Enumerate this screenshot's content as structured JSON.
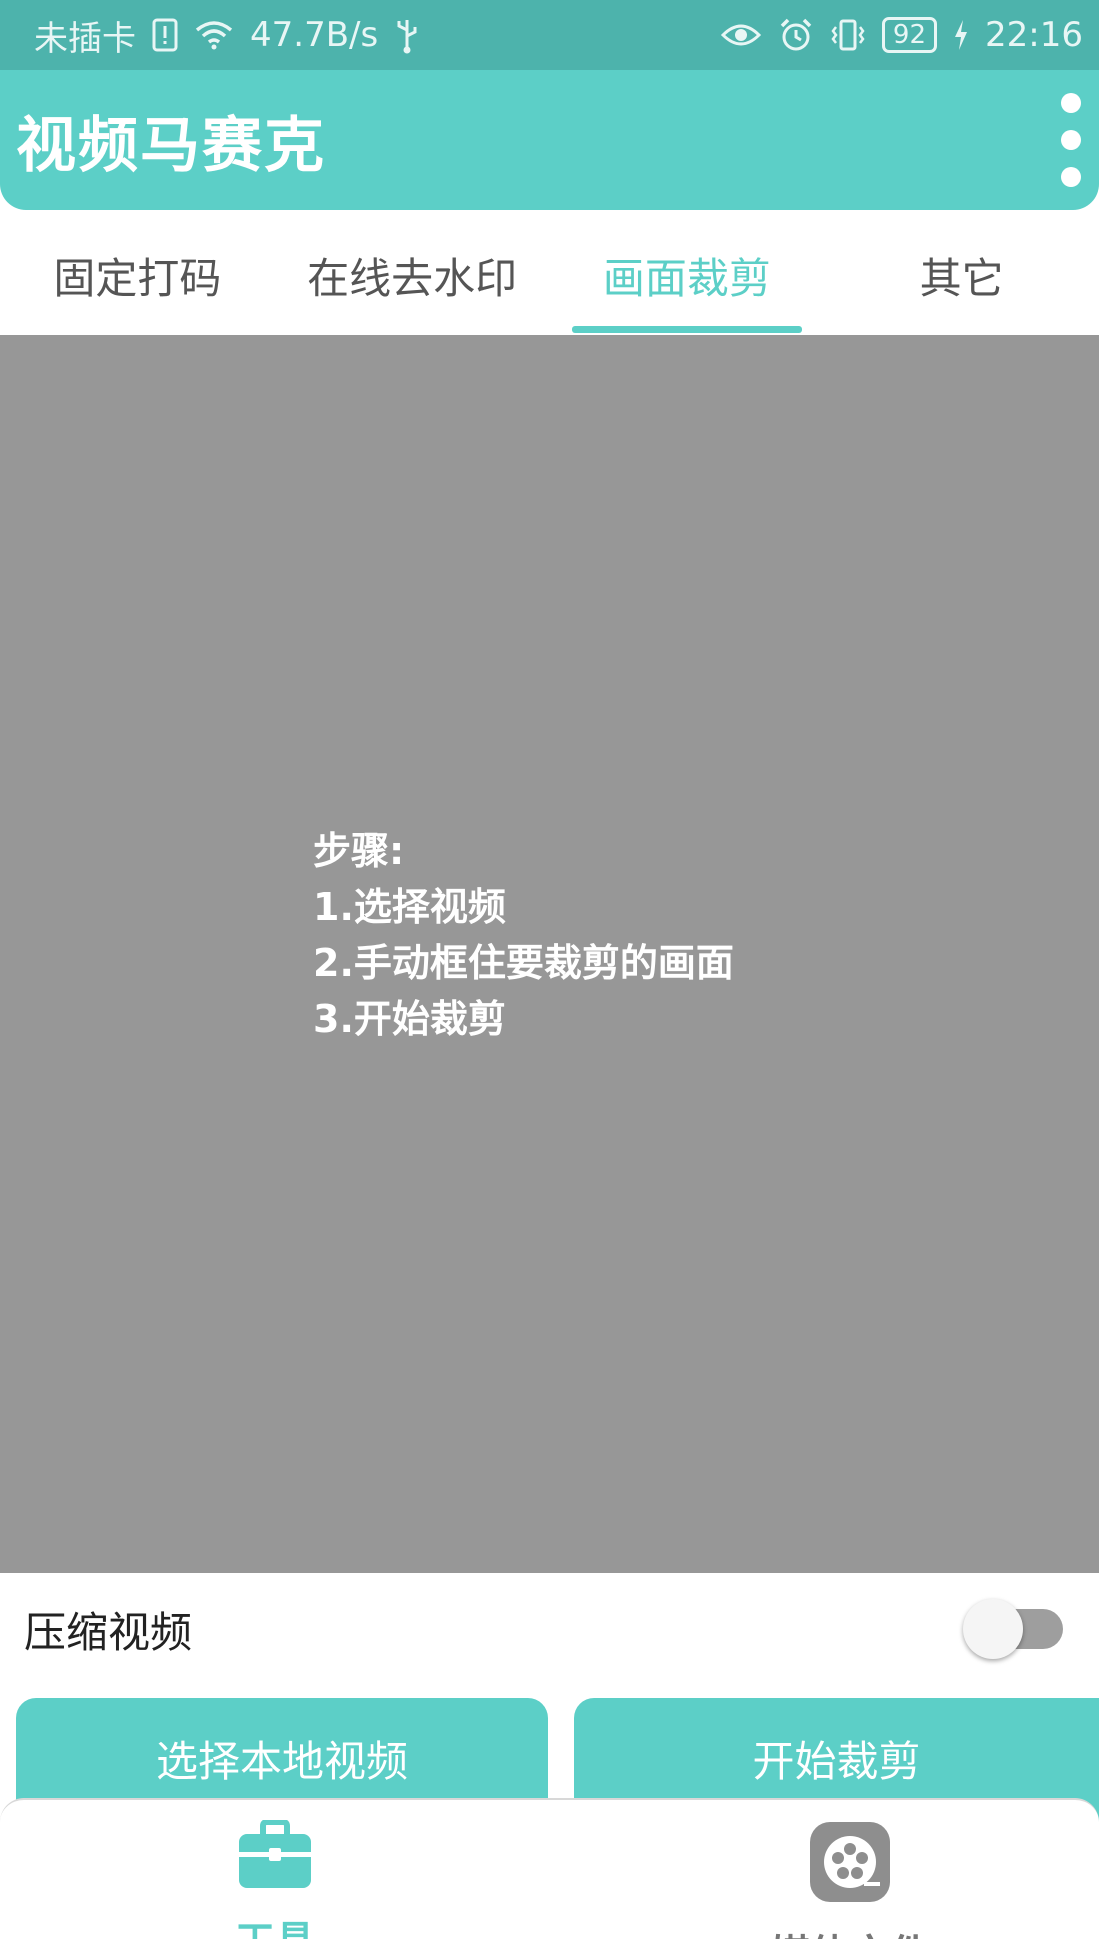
{
  "status_bar": {
    "carrier": "未插卡",
    "speed": "47.7B/s",
    "battery": "92",
    "time": "22:16"
  },
  "app_bar": {
    "title": "视频马赛克"
  },
  "tabs": [
    {
      "label": "固定打码",
      "active": false
    },
    {
      "label": "在线去水印",
      "active": false
    },
    {
      "label": "画面裁剪",
      "active": true
    },
    {
      "label": "其它",
      "active": false
    }
  ],
  "preview": {
    "steps": [
      "步骤:",
      "1.选择视频",
      "2.手动框住要裁剪的画面",
      "3.开始裁剪"
    ]
  },
  "compress": {
    "label": "压缩视频",
    "enabled": false
  },
  "actions": {
    "select_label": "选择本地视频",
    "start_label": "开始裁剪"
  },
  "bottom_nav": {
    "items": [
      {
        "label": "工具",
        "icon": "toolbox-icon",
        "active": true
      },
      {
        "label": "媒体文件",
        "icon": "film-reel-icon",
        "active": false
      }
    ]
  },
  "colors": {
    "accent": "#5ccfc7",
    "status_bar": "#4db3ac",
    "preview_bg": "#979797"
  }
}
